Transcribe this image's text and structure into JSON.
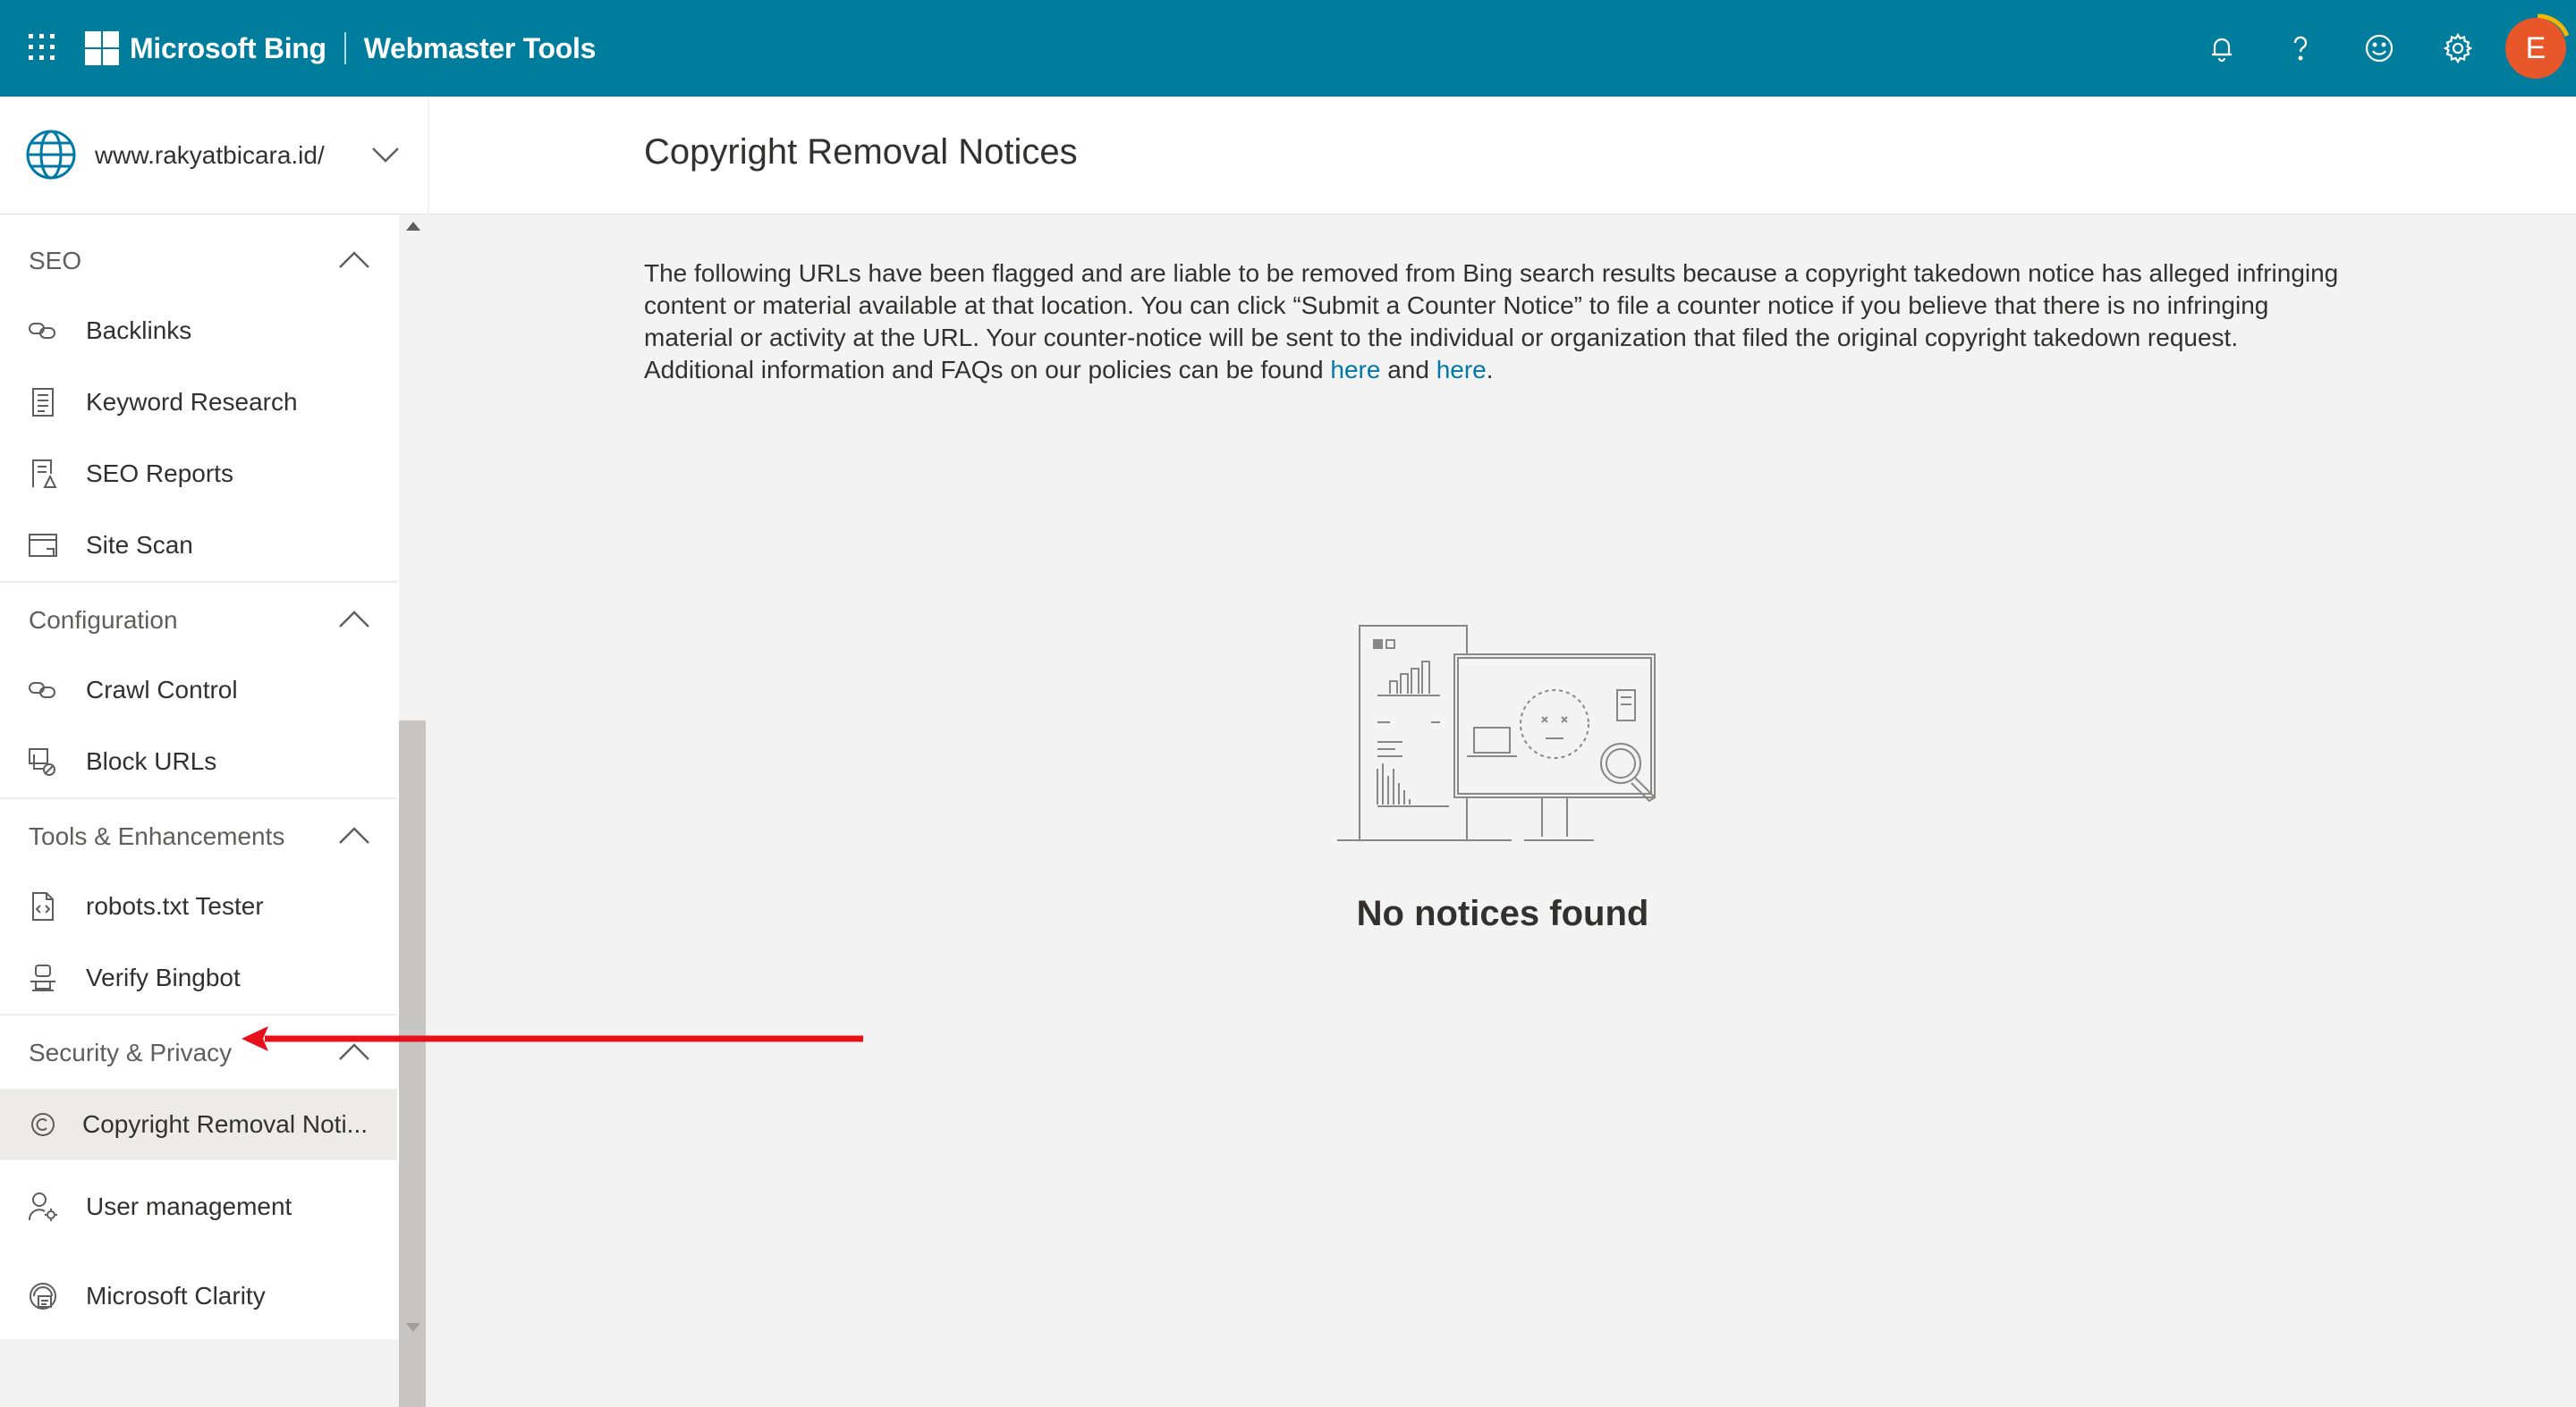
{
  "header": {
    "brand": "Microsoft Bing",
    "product": "Webmaster Tools",
    "avatar_initial": "E",
    "icons": [
      "waffle-icon",
      "bell-icon",
      "help-icon",
      "smiley-icon",
      "gear-icon"
    ]
  },
  "site": {
    "name": "www.rakyatbicara.id/"
  },
  "sidebar": {
    "sections": [
      {
        "title": "SEO",
        "items": [
          "Backlinks",
          "Keyword Research",
          "SEO Reports",
          "Site Scan"
        ]
      },
      {
        "title": "Configuration",
        "items": [
          "Crawl Control",
          "Block URLs"
        ]
      },
      {
        "title": "Tools & Enhancements",
        "items": [
          "robots.txt Tester",
          "Verify Bingbot"
        ]
      },
      {
        "title": "Security & Privacy",
        "items": [
          "Copyright Removal Noti..."
        ]
      }
    ],
    "extra_items": [
      "User management",
      "Microsoft Clarity"
    ],
    "active_item": "Copyright Removal Noti..."
  },
  "main": {
    "title": "Copyright Removal Notices",
    "description_1": "The following URLs have been flagged and are liable to be removed from Bing search results because a copyright takedown notice has alleged infringing content or material available at that location. You can click “Submit a Counter Notice” to file a counter notice if you believe that there is no infringing material or activity at the URL. Your counter-notice will be sent to the individual or organization that filed the original copyright takedown request. Additional information and FAQs on our policies can be found ",
    "link_1": "here",
    "description_and": " and ",
    "link_2": "here",
    "description_end": ".",
    "empty_state": "No notices found"
  },
  "colors": {
    "topbar": "#007c9d",
    "avatar": "#e8572a",
    "link": "#0078a8",
    "annotation_arrow": "#e8101a"
  }
}
